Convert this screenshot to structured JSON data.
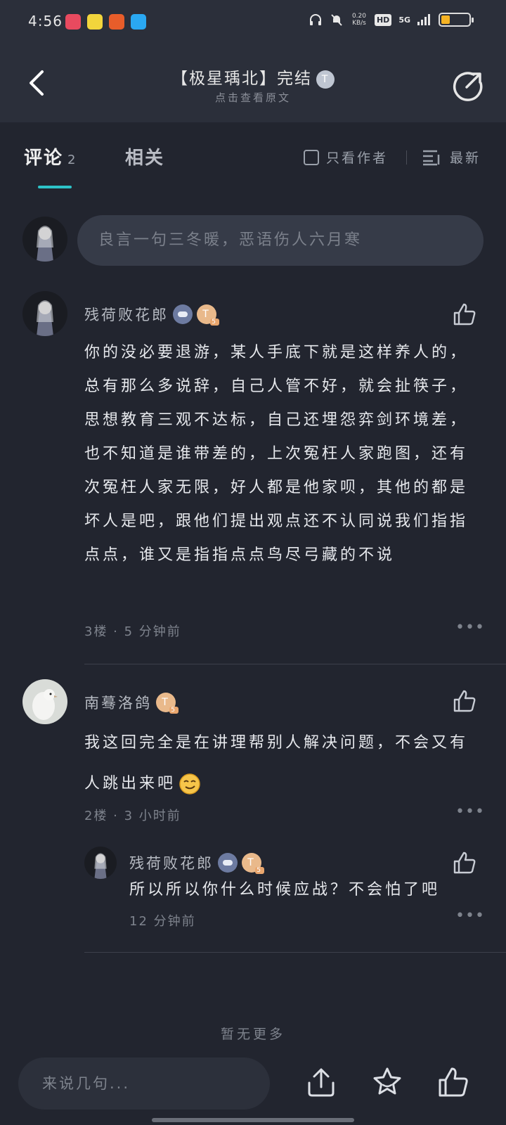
{
  "status_bar": {
    "time": "4:56",
    "net_speed_top": "0.20",
    "net_speed_bottom": "KB/s",
    "hd": "HD",
    "network": "5G",
    "app_icon_colors": [
      "#e84a5f",
      "#f2d53c",
      "#e85d2a",
      "#2aa8f2"
    ]
  },
  "header": {
    "title": "【极星瑀北】完结",
    "title_badge": "T",
    "subtitle": "点击查看原文"
  },
  "tabs": {
    "comments_label": "评论",
    "comments_count": "2",
    "related_label": "相关",
    "author_only_label": "只看作者",
    "sort_label": "最新",
    "accent_color": "#2dc3c8"
  },
  "comment_input": {
    "placeholder": "良言一句三冬暖，恶语伤人六月寒"
  },
  "comments": [
    {
      "username": "残荷败花郎",
      "badges": [
        "game-badge",
        "T"
      ],
      "badge_level": "5",
      "text": "你的没必要退游，某人手底下就是这样养人的，总有那么多说辞，自己人管不好，就会扯筷子，思想教育三观不达标，自己还埋怨弈剑环境差，也不知道是谁带差的，上次冤枉人家跑图，还有次冤枉人家无限，好人都是他家呗，其他的都是坏人是吧，跟他们提出观点还不认同说我们指指点点，谁又是指指点点鸟尽弓藏的不说",
      "meta": "3楼 · 5 分钟前"
    },
    {
      "username": "南蓦洛鸽",
      "badges": [
        "T"
      ],
      "badge_level": "5",
      "text": "我这回完全是在讲理帮别人解决问题，不会又有人跳出来吧",
      "meta": "2楼 · 3 小时前",
      "reply": {
        "username": "残荷败花郎",
        "badges": [
          "game-badge",
          "T"
        ],
        "badge_level": "5",
        "text": "所以所以你什么时候应战？不会怕了吧",
        "meta": "12 分钟前"
      }
    }
  ],
  "no_more": "暂无更多",
  "bottom_bar": {
    "input_placeholder": "来说几句..."
  }
}
